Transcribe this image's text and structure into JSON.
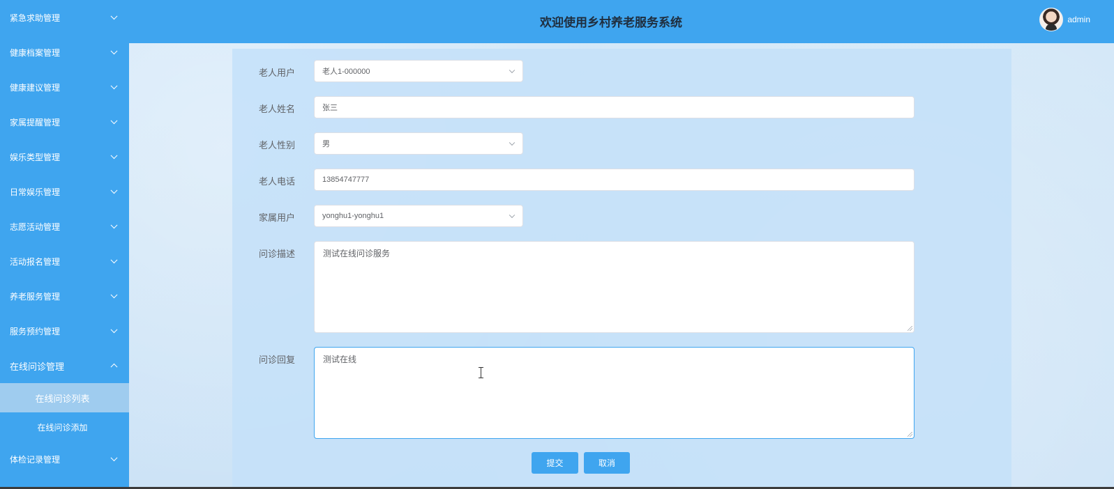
{
  "sidebar": {
    "items": [
      {
        "label": "紧急求助管理"
      },
      {
        "label": "健康档案管理"
      },
      {
        "label": "健康建议管理"
      },
      {
        "label": "家属提醒管理"
      },
      {
        "label": "娱乐类型管理"
      },
      {
        "label": "日常娱乐管理"
      },
      {
        "label": "志愿活动管理"
      },
      {
        "label": "活动报名管理"
      },
      {
        "label": "养老服务管理"
      },
      {
        "label": "服务预约管理"
      },
      {
        "label": "在线问诊管理",
        "expanded": true
      },
      {
        "label": "体检记录管理"
      }
    ],
    "sub_items": [
      {
        "label": "在线问诊列表",
        "active": true
      },
      {
        "label": "在线问诊添加"
      }
    ]
  },
  "header": {
    "title": "欢迎使用乡村养老服务系统",
    "username": "admin"
  },
  "form": {
    "elder_user": {
      "label": "老人用户",
      "value": "老人1-000000"
    },
    "elder_name": {
      "label": "老人姓名",
      "value": "张三"
    },
    "elder_gender": {
      "label": "老人性别",
      "value": "男"
    },
    "elder_phone": {
      "label": "老人电话",
      "value": "13854747777"
    },
    "family_user": {
      "label": "家属用户",
      "value": "yonghu1-yonghu1"
    },
    "consult_desc": {
      "label": "问诊描述",
      "value": "测试在线问诊服务"
    },
    "consult_reply": {
      "label": "问诊回复",
      "value": "测试在线"
    },
    "submit_label": "提交",
    "cancel_label": "取消"
  },
  "colors": {
    "primary": "#3fa5ef",
    "sidebar_active": "#9fccef",
    "background": "#cfe5f7"
  },
  "icons": {
    "menu_expand": "chevron-down-icon",
    "menu_collapse": "chevron-up-icon",
    "select_dropdown": "chevron-down-icon",
    "avatar": "user-avatar"
  }
}
